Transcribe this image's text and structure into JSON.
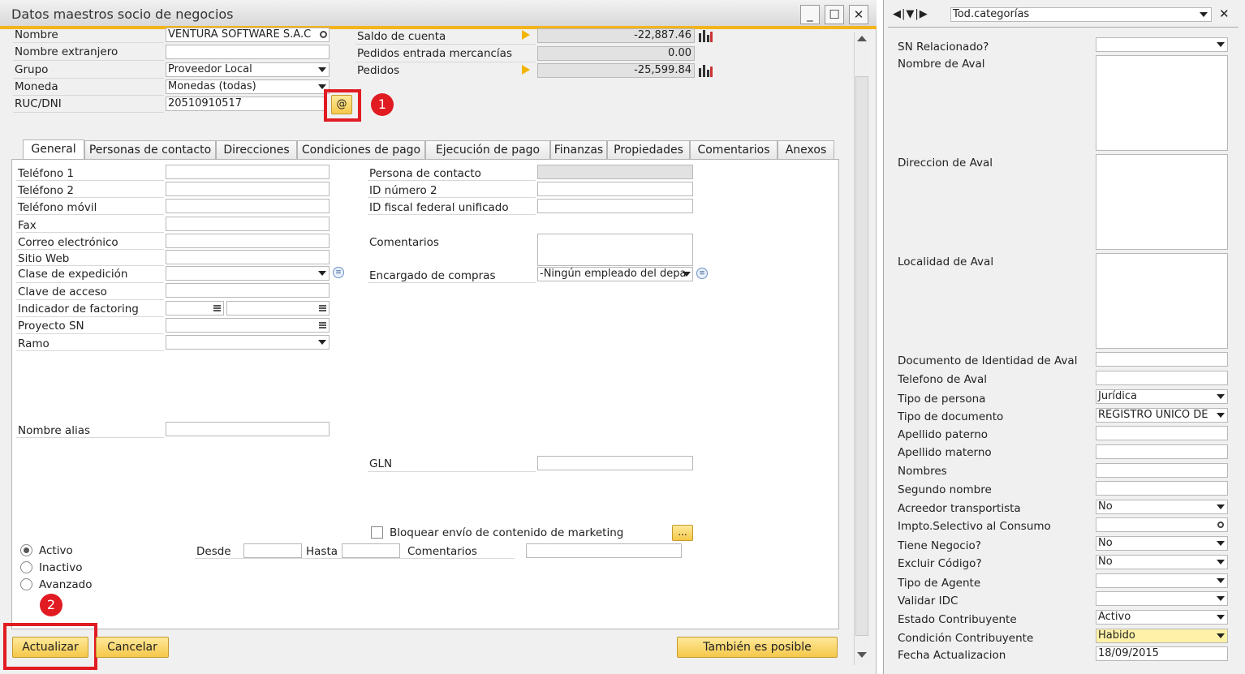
{
  "window": {
    "title": "Datos maestros socio de negocios"
  },
  "header": {
    "nombre_label": "Nombre",
    "nombre_value": "VENTURA SOFTWARE S.A.C",
    "nombre_ext_label": "Nombre extranjero",
    "grupo_label": "Grupo",
    "grupo_value": "Proveedor Local",
    "moneda_label": "Moneda",
    "moneda_value": "Monedas (todas)",
    "ruc_label": "RUC/DNI",
    "ruc_value": "20510910517",
    "saldo_label": "Saldo de cuenta",
    "saldo_value": "-22,887.46",
    "pedidos_entrada_label": "Pedidos entrada mercancías",
    "pedidos_entrada_value": "0.00",
    "pedidos_label": "Pedidos",
    "pedidos_value": "-25,599.84"
  },
  "badges": {
    "one": "1",
    "two": "2"
  },
  "tabs": [
    "General",
    "Personas de contacto",
    "Direcciones",
    "Condiciones de pago",
    "Ejecución de pago",
    "Finanzas",
    "Propiedades",
    "Comentarios",
    "Anexos"
  ],
  "general": {
    "telefono1": "Teléfono 1",
    "telefono2": "Teléfono 2",
    "movil": "Teléfono móvil",
    "fax": "Fax",
    "correo": "Correo electrónico",
    "sitio": "Sitio Web",
    "clase_exp": "Clase de expedición",
    "clave": "Clave de acceso",
    "factoring": "Indicador de factoring",
    "proyecto": "Proyecto SN",
    "ramo": "Ramo",
    "alias": "Nombre alias",
    "persona_contacto": "Persona de contacto",
    "id_numero2": "ID número 2",
    "id_fiscal": "ID fiscal federal unificado",
    "comentarios": "Comentarios",
    "encargado": "Encargado de compras",
    "encargado_value": "-Ningún empleado del depa",
    "gln": "GLN",
    "bloquear": "Bloquear envío de contenido de marketing",
    "ellipsis": "...",
    "activo": "Activo",
    "inactivo": "Inactivo",
    "avanzado": "Avanzado",
    "desde": "Desde",
    "hasta": "Hasta",
    "comentarios2": "Comentarios"
  },
  "buttons": {
    "actualizar": "Actualizar",
    "cancelar": "Cancelar",
    "tambien": "También es posible"
  },
  "right": {
    "categoria": "Tod.categorías",
    "fields": {
      "sn_rel": "SN Relacionado?",
      "nombre_aval": "Nombre de Aval",
      "direccion_aval": "Direccion de Aval",
      "localidad_aval": "Localidad de Aval",
      "doc_aval": "Documento de Identidad de Aval",
      "tel_aval": "Telefono de Aval",
      "tipo_persona": "Tipo de persona",
      "tipo_persona_v": "Jurídica",
      "tipo_doc": "Tipo de documento",
      "tipo_doc_v": "REGISTRO ÚNICO DE",
      "ap_paterno": "Apellido paterno",
      "ap_materno": "Apellido materno",
      "nombres": "Nombres",
      "segundo": "Segundo nombre",
      "acreedor": "Acreedor transportista",
      "acreedor_v": "No",
      "impto": "Impto.Selectivo al Consumo",
      "negocio": "Tiene Negocio?",
      "negocio_v": "No",
      "excluir": "Excluir Código?",
      "excluir_v": "No",
      "agente": "Tipo de Agente",
      "validar": "Validar IDC",
      "estado": "Estado Contribuyente",
      "estado_v": "Activo",
      "condicion": "Condición Contribuyente",
      "condicion_v": "Habido",
      "fecha": "Fecha Actualizacion",
      "fecha_v": "18/09/2015"
    }
  },
  "colors": {
    "accent": "#f3b31b",
    "highlight": "#e11b22",
    "button": "#f5c84a"
  }
}
